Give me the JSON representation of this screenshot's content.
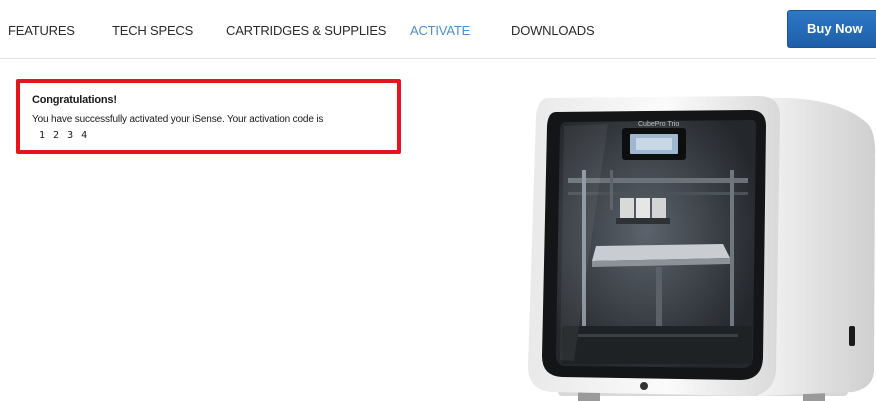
{
  "nav": {
    "items": [
      {
        "label": "FEATURES",
        "active": false
      },
      {
        "label": "TECH SPECS",
        "active": false
      },
      {
        "label": "CARTRIDGES & SUPPLIES",
        "active": false
      },
      {
        "label": "ACTIVATE",
        "active": true
      },
      {
        "label": "DOWNLOADS",
        "active": false
      }
    ],
    "buy_label": "Buy Now"
  },
  "message": {
    "title": "Congratulations!",
    "body": "You have successfully activated your iSense. Your activation code is",
    "code": "1 2 3 4"
  },
  "product": {
    "screen_label": "CubePro Trio"
  },
  "colors": {
    "active_nav": "#4a90d0",
    "buy_button": "#1d5fa8",
    "message_border": "#e8141b"
  }
}
